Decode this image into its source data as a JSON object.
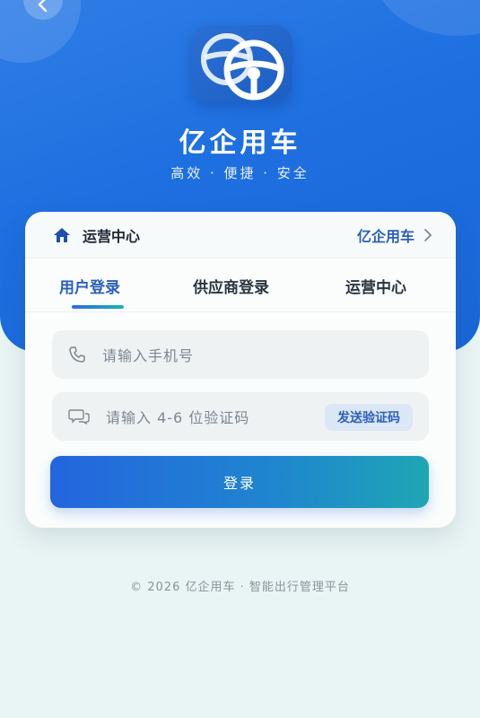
{
  "hero": {
    "back_icon": "chevron-left-icon",
    "logo_icon": "steering-wheel-icon",
    "title": "亿企用车",
    "subtitle": "高效 · 便捷 · 安全"
  },
  "card": {
    "header": {
      "left_icon": "home-icon",
      "left_label": "运营中心",
      "right_label": "亿企用车",
      "right_icon": "chevron-right-icon"
    },
    "tabs": [
      {
        "label": "用户登录",
        "active": true
      },
      {
        "label": "供应商登录",
        "active": false
      },
      {
        "label": "运营中心",
        "active": false
      }
    ],
    "phone_field": {
      "icon": "phone-icon",
      "placeholder": "请输入手机号"
    },
    "code_field": {
      "icon": "chat-icon",
      "placeholder": "请输入 4-6 位验证码",
      "send_label": "发送验证码"
    },
    "login_label": "登录"
  },
  "footer": {
    "text": "© 2026 亿企用车 · 智能出行管理平台"
  },
  "colors": {
    "primary": "#1e6fe0",
    "accent": "#1fa6b4",
    "link": "#2b5fb8"
  }
}
